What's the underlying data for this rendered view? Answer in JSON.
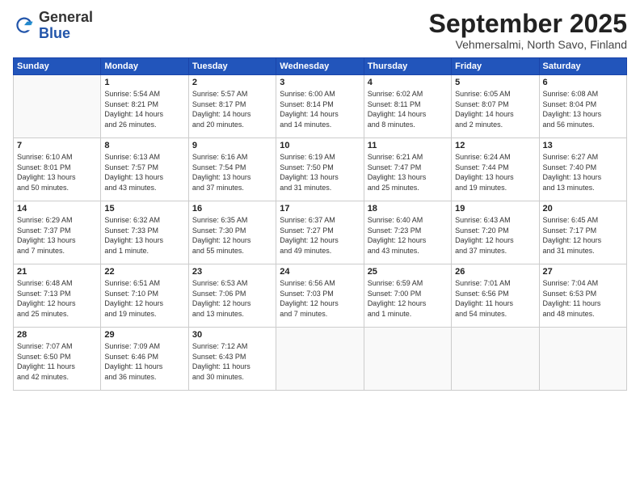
{
  "header": {
    "logo_general": "General",
    "logo_blue": "Blue",
    "month_title": "September 2025",
    "location": "Vehmersalmi, North Savo, Finland"
  },
  "weekdays": [
    "Sunday",
    "Monday",
    "Tuesday",
    "Wednesday",
    "Thursday",
    "Friday",
    "Saturday"
  ],
  "weeks": [
    [
      {
        "day": "",
        "info": ""
      },
      {
        "day": "1",
        "info": "Sunrise: 5:54 AM\nSunset: 8:21 PM\nDaylight: 14 hours\nand 26 minutes."
      },
      {
        "day": "2",
        "info": "Sunrise: 5:57 AM\nSunset: 8:17 PM\nDaylight: 14 hours\nand 20 minutes."
      },
      {
        "day": "3",
        "info": "Sunrise: 6:00 AM\nSunset: 8:14 PM\nDaylight: 14 hours\nand 14 minutes."
      },
      {
        "day": "4",
        "info": "Sunrise: 6:02 AM\nSunset: 8:11 PM\nDaylight: 14 hours\nand 8 minutes."
      },
      {
        "day": "5",
        "info": "Sunrise: 6:05 AM\nSunset: 8:07 PM\nDaylight: 14 hours\nand 2 minutes."
      },
      {
        "day": "6",
        "info": "Sunrise: 6:08 AM\nSunset: 8:04 PM\nDaylight: 13 hours\nand 56 minutes."
      }
    ],
    [
      {
        "day": "7",
        "info": "Sunrise: 6:10 AM\nSunset: 8:01 PM\nDaylight: 13 hours\nand 50 minutes."
      },
      {
        "day": "8",
        "info": "Sunrise: 6:13 AM\nSunset: 7:57 PM\nDaylight: 13 hours\nand 43 minutes."
      },
      {
        "day": "9",
        "info": "Sunrise: 6:16 AM\nSunset: 7:54 PM\nDaylight: 13 hours\nand 37 minutes."
      },
      {
        "day": "10",
        "info": "Sunrise: 6:19 AM\nSunset: 7:50 PM\nDaylight: 13 hours\nand 31 minutes."
      },
      {
        "day": "11",
        "info": "Sunrise: 6:21 AM\nSunset: 7:47 PM\nDaylight: 13 hours\nand 25 minutes."
      },
      {
        "day": "12",
        "info": "Sunrise: 6:24 AM\nSunset: 7:44 PM\nDaylight: 13 hours\nand 19 minutes."
      },
      {
        "day": "13",
        "info": "Sunrise: 6:27 AM\nSunset: 7:40 PM\nDaylight: 13 hours\nand 13 minutes."
      }
    ],
    [
      {
        "day": "14",
        "info": "Sunrise: 6:29 AM\nSunset: 7:37 PM\nDaylight: 13 hours\nand 7 minutes."
      },
      {
        "day": "15",
        "info": "Sunrise: 6:32 AM\nSunset: 7:33 PM\nDaylight: 13 hours\nand 1 minute."
      },
      {
        "day": "16",
        "info": "Sunrise: 6:35 AM\nSunset: 7:30 PM\nDaylight: 12 hours\nand 55 minutes."
      },
      {
        "day": "17",
        "info": "Sunrise: 6:37 AM\nSunset: 7:27 PM\nDaylight: 12 hours\nand 49 minutes."
      },
      {
        "day": "18",
        "info": "Sunrise: 6:40 AM\nSunset: 7:23 PM\nDaylight: 12 hours\nand 43 minutes."
      },
      {
        "day": "19",
        "info": "Sunrise: 6:43 AM\nSunset: 7:20 PM\nDaylight: 12 hours\nand 37 minutes."
      },
      {
        "day": "20",
        "info": "Sunrise: 6:45 AM\nSunset: 7:17 PM\nDaylight: 12 hours\nand 31 minutes."
      }
    ],
    [
      {
        "day": "21",
        "info": "Sunrise: 6:48 AM\nSunset: 7:13 PM\nDaylight: 12 hours\nand 25 minutes."
      },
      {
        "day": "22",
        "info": "Sunrise: 6:51 AM\nSunset: 7:10 PM\nDaylight: 12 hours\nand 19 minutes."
      },
      {
        "day": "23",
        "info": "Sunrise: 6:53 AM\nSunset: 7:06 PM\nDaylight: 12 hours\nand 13 minutes."
      },
      {
        "day": "24",
        "info": "Sunrise: 6:56 AM\nSunset: 7:03 PM\nDaylight: 12 hours\nand 7 minutes."
      },
      {
        "day": "25",
        "info": "Sunrise: 6:59 AM\nSunset: 7:00 PM\nDaylight: 12 hours\nand 1 minute."
      },
      {
        "day": "26",
        "info": "Sunrise: 7:01 AM\nSunset: 6:56 PM\nDaylight: 11 hours\nand 54 minutes."
      },
      {
        "day": "27",
        "info": "Sunrise: 7:04 AM\nSunset: 6:53 PM\nDaylight: 11 hours\nand 48 minutes."
      }
    ],
    [
      {
        "day": "28",
        "info": "Sunrise: 7:07 AM\nSunset: 6:50 PM\nDaylight: 11 hours\nand 42 minutes."
      },
      {
        "day": "29",
        "info": "Sunrise: 7:09 AM\nSunset: 6:46 PM\nDaylight: 11 hours\nand 36 minutes."
      },
      {
        "day": "30",
        "info": "Sunrise: 7:12 AM\nSunset: 6:43 PM\nDaylight: 11 hours\nand 30 minutes."
      },
      {
        "day": "",
        "info": ""
      },
      {
        "day": "",
        "info": ""
      },
      {
        "day": "",
        "info": ""
      },
      {
        "day": "",
        "info": ""
      }
    ]
  ]
}
